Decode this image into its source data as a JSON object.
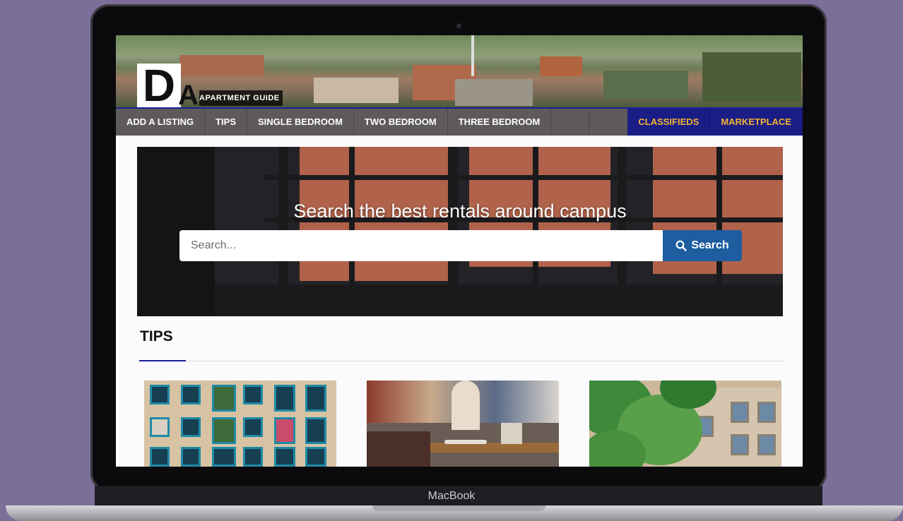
{
  "device": {
    "brand": "MacBook"
  },
  "header": {
    "logo_letters": "DA",
    "logo_text": "APARTMENT GUIDE"
  },
  "nav": {
    "items": [
      "ADD A LISTING",
      "TIPS",
      "SINGLE BEDROOM",
      "TWO BEDROOM",
      "THREE BEDROOM"
    ],
    "right_items": [
      "CLASSIFIEDS",
      "MARKETPLACE"
    ]
  },
  "hero": {
    "title": "Search the best rentals around campus",
    "search_placeholder": "Search...",
    "search_button": "Search"
  },
  "tips": {
    "title": "TIPS",
    "cards": [
      {
        "image": "apartment-balconies"
      },
      {
        "image": "restaurant-table"
      },
      {
        "image": "building-with-trees"
      }
    ]
  },
  "colors": {
    "nav_bg": "#5e5a5a",
    "nav_accent_bg": "#1a1d86",
    "nav_accent_text": "#f2b335",
    "search_button": "#1d5da0",
    "background": "#7b6f99"
  }
}
